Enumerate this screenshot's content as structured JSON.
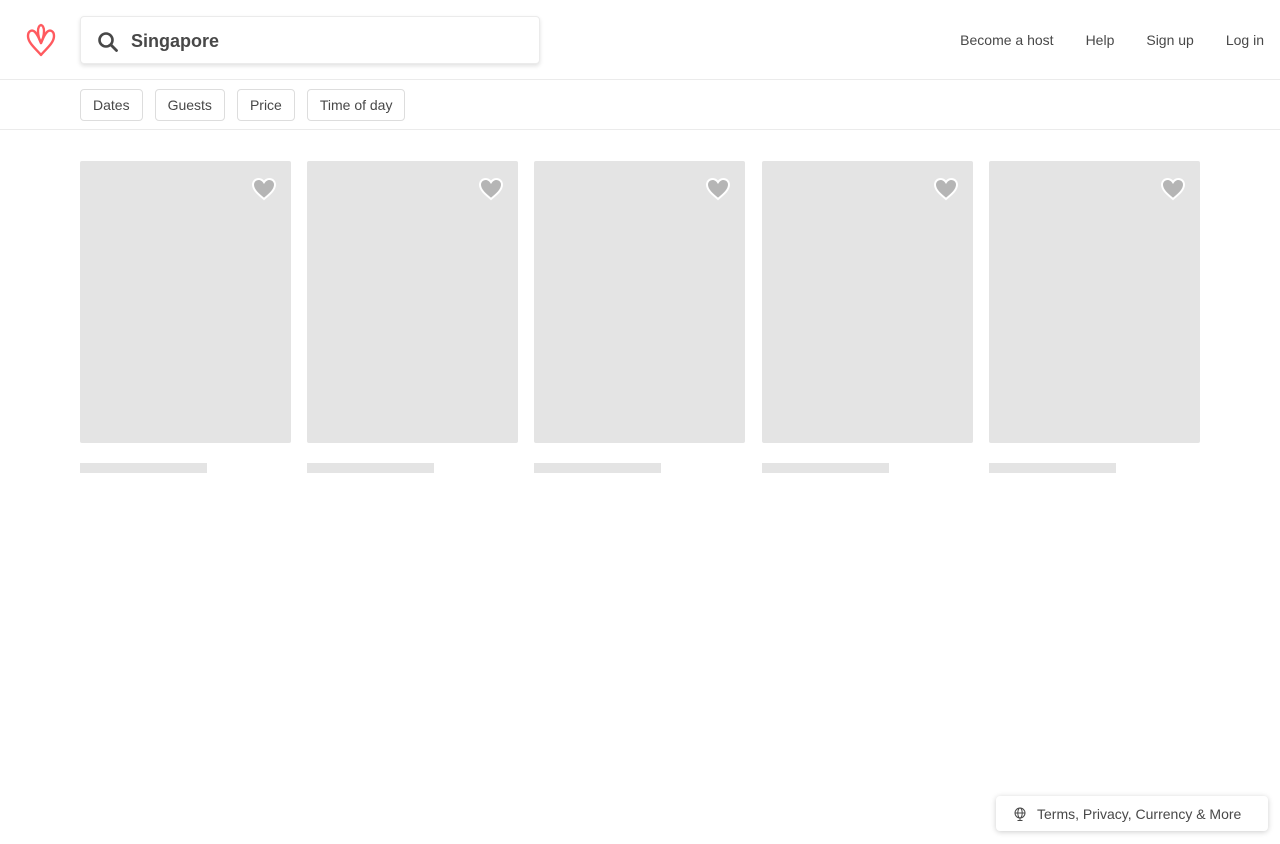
{
  "colors": {
    "brand": "#FF5A5F",
    "text": "#484848",
    "placeholder_gray": "#E4E4E4"
  },
  "search": {
    "value": "Singapore",
    "icon": "search-icon"
  },
  "nav": {
    "become_host": "Become a host",
    "help": "Help",
    "sign_up": "Sign up",
    "log_in": "Log in"
  },
  "filters": {
    "dates": "Dates",
    "guests": "Guests",
    "price": "Price",
    "time_of_day": "Time of day"
  },
  "listings": {
    "count_loading": 5,
    "save_icon": "heart-icon"
  },
  "footer": {
    "label": "Terms, Privacy, Currency & More",
    "icon": "globe-icon"
  }
}
